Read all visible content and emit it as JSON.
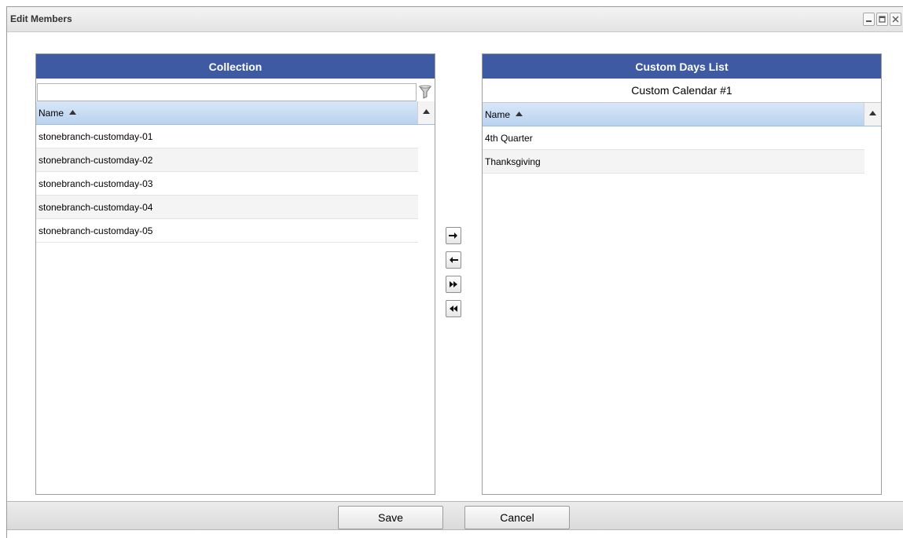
{
  "window": {
    "title": "Edit Members",
    "controls": [
      "minimize-icon",
      "maximize-icon",
      "close-icon"
    ]
  },
  "collection": {
    "header": "Collection",
    "filter": {
      "value": "",
      "placeholder": ""
    },
    "column": "Name",
    "rows": [
      "stonebranch-customday-01",
      "stonebranch-customday-02",
      "stonebranch-customday-03",
      "stonebranch-customday-04",
      "stonebranch-customday-05"
    ]
  },
  "custom_days": {
    "header": "Custom Days List",
    "subtitle": "Custom Calendar #1",
    "column": "Name",
    "rows": [
      "4th Quarter",
      "Thanksgiving"
    ]
  },
  "transfer_buttons": [
    "arrow-right-icon",
    "arrow-left-icon",
    "double-arrow-right-icon",
    "double-arrow-left-icon"
  ],
  "footer": {
    "save_label": "Save",
    "cancel_label": "Cancel"
  },
  "colors": {
    "panel_header": "#3d5aa3",
    "grid_header": "#b9d2ef"
  }
}
